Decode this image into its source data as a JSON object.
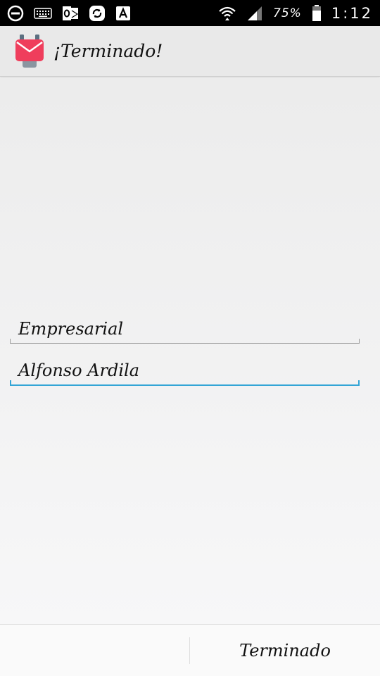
{
  "status_bar": {
    "battery_percent": "75%",
    "time": "1:12",
    "left_icons": [
      "do-not-disturb-icon",
      "keyboard-icon",
      "outlook-icon",
      "sync-icon",
      "font-icon"
    ],
    "right_icons": [
      "wifi-icon",
      "signal-icon",
      "battery-icon"
    ]
  },
  "action_bar": {
    "title": "¡Terminado!",
    "icon": "app-envelope-icon",
    "icon_color": "#ef3e5c"
  },
  "form": {
    "company_value": "Empresarial",
    "name_value": "Alfonso Ardila",
    "focus_color": "#33a5d6"
  },
  "bottom_bar": {
    "done_label": "Terminado"
  }
}
